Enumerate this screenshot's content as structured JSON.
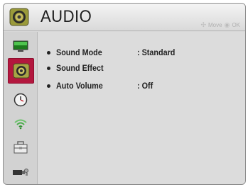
{
  "header": {
    "title": "AUDIO",
    "icon": "speaker-icon",
    "hint": {
      "move_label": "Move",
      "ok_label": "OK",
      "move_icon": "dpad-icon",
      "ok_icon": "ok-button-icon"
    }
  },
  "sidebar": {
    "items": [
      {
        "name": "picture",
        "icon": "monitor-icon"
      },
      {
        "name": "audio",
        "icon": "speaker-icon",
        "selected": true
      },
      {
        "name": "time",
        "icon": "clock-icon"
      },
      {
        "name": "network",
        "icon": "wifi-icon"
      },
      {
        "name": "option",
        "icon": "toolbox-icon"
      },
      {
        "name": "input",
        "icon": "input-plug-icon"
      }
    ]
  },
  "menu": {
    "items": [
      {
        "label": "Sound Mode",
        "value": ": Standard"
      },
      {
        "label": "Sound Effect",
        "value": ""
      },
      {
        "label": "Auto Volume",
        "value": ": Off"
      }
    ]
  },
  "colors": {
    "accent": "#b3173e",
    "background": "#dcdcdc",
    "header": "#e8e8e8"
  }
}
